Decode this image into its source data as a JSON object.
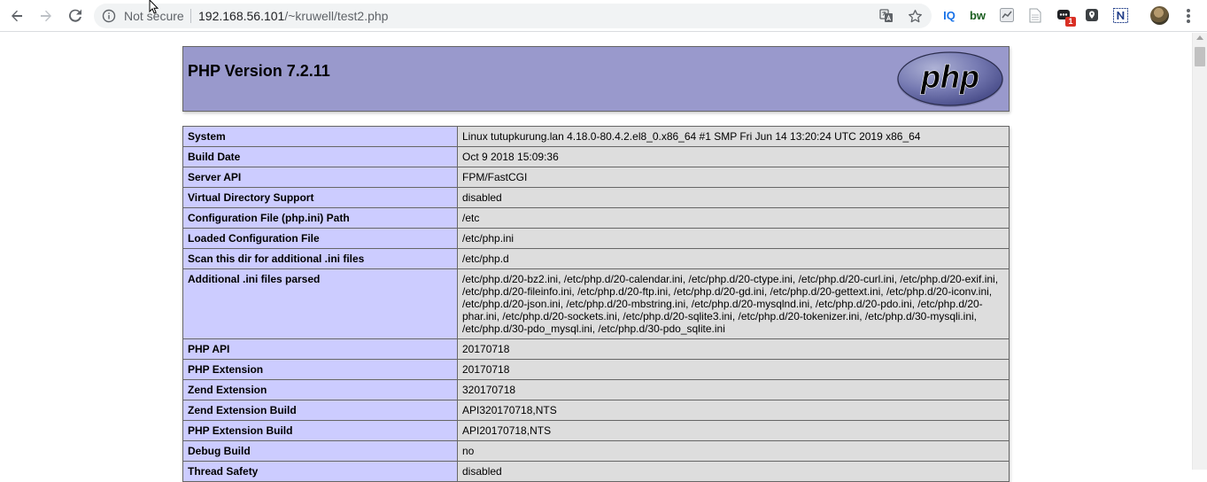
{
  "browser": {
    "security_label": "Not secure",
    "url_host": "192.168.56.101",
    "url_path": "/~kruwell/test2.php",
    "extension_badge": "1",
    "extensions": [
      {
        "name": "iq-extension-icon",
        "label": "IQ",
        "color": "#1a73e8"
      },
      {
        "name": "bw-extension-icon",
        "label": "bw",
        "color": "#2e7d32"
      }
    ]
  },
  "page": {
    "title": "PHP Version 7.2.11",
    "logo_text": "php",
    "colors": {
      "header": "#9999cc",
      "key_cell": "#ccccff",
      "value_cell": "#dddddd"
    },
    "rows": [
      {
        "key": "System",
        "value": "Linux tutupkurung.lan 4.18.0-80.4.2.el8_0.x86_64 #1 SMP Fri Jun 14 13:20:24 UTC 2019 x86_64"
      },
      {
        "key": "Build Date",
        "value": "Oct 9 2018 15:09:36"
      },
      {
        "key": "Server API",
        "value": "FPM/FastCGI"
      },
      {
        "key": "Virtual Directory Support",
        "value": "disabled"
      },
      {
        "key": "Configuration File (php.ini) Path",
        "value": "/etc"
      },
      {
        "key": "Loaded Configuration File",
        "value": "/etc/php.ini"
      },
      {
        "key": "Scan this dir for additional .ini files",
        "value": "/etc/php.d"
      },
      {
        "key": "Additional .ini files parsed",
        "value": "/etc/php.d/20-bz2.ini, /etc/php.d/20-calendar.ini, /etc/php.d/20-ctype.ini, /etc/php.d/20-curl.ini, /etc/php.d/20-exif.ini, /etc/php.d/20-fileinfo.ini, /etc/php.d/20-ftp.ini, /etc/php.d/20-gd.ini, /etc/php.d/20-gettext.ini, /etc/php.d/20-iconv.ini, /etc/php.d/20-json.ini, /etc/php.d/20-mbstring.ini, /etc/php.d/20-mysqlnd.ini, /etc/php.d/20-pdo.ini, /etc/php.d/20-phar.ini, /etc/php.d/20-sockets.ini, /etc/php.d/20-sqlite3.ini, /etc/php.d/20-tokenizer.ini, /etc/php.d/30-mysqli.ini, /etc/php.d/30-pdo_mysql.ini, /etc/php.d/30-pdo_sqlite.ini"
      },
      {
        "key": "PHP API",
        "value": "20170718"
      },
      {
        "key": "PHP Extension",
        "value": "20170718"
      },
      {
        "key": "Zend Extension",
        "value": "320170718"
      },
      {
        "key": "Zend Extension Build",
        "value": "API320170718,NTS"
      },
      {
        "key": "PHP Extension Build",
        "value": "API20170718,NTS"
      },
      {
        "key": "Debug Build",
        "value": "no"
      },
      {
        "key": "Thread Safety",
        "value": "disabled"
      }
    ]
  }
}
